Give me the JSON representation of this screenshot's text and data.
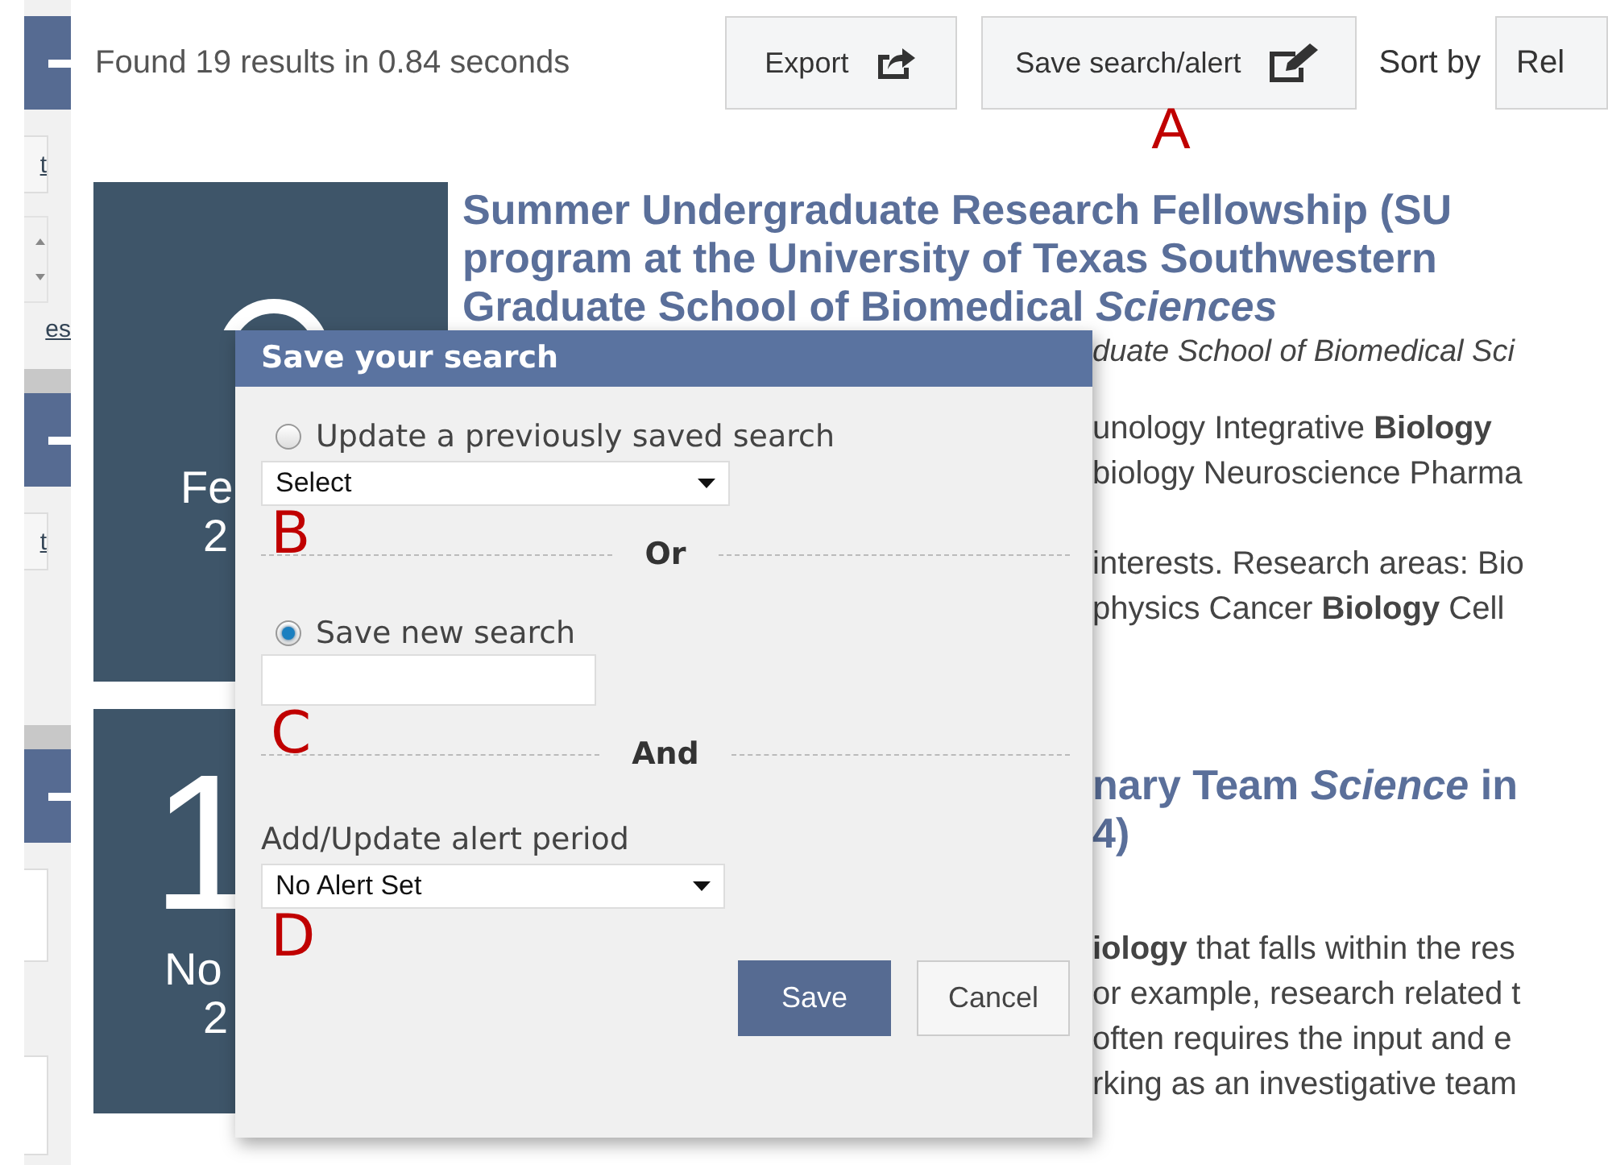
{
  "sidebar": {
    "links": [
      "t",
      "es",
      "t"
    ]
  },
  "toolbar": {
    "summary": "Found 19 results in 0.84 seconds",
    "buttons": [
      {
        "label": "Export",
        "kind": "export"
      },
      {
        "label": "Save search/alert",
        "kind": "edit",
        "annotation": "A"
      }
    ],
    "sort_label": "Sort by",
    "sort_value": "Rel"
  },
  "results": [
    {
      "date": {
        "month": "Fe",
        "year": "2"
      },
      "title_lines": [
        "Summer Undergraduate Research Fellowship (SU",
        "program at the University of Texas Southwestern",
        "Graduate School of Biomedical *Sciences*"
      ],
      "subtitle": "duate School of Biomedical Sci",
      "paragraphs": [
        [
          "unology Integrative **Biology**",
          "biology Neuroscience Pharma"
        ],
        [
          "interests. Research areas: Bio",
          "physics Cancer **Biology** Cell"
        ]
      ]
    },
    {
      "date": {
        "day": "1",
        "month": "No",
        "year": "2"
      },
      "title_lines": [
        "nary Team *Science* in",
        "4)"
      ],
      "paragraphs": [
        [
          "**iology** that falls within the res",
          "or example, research related t",
          "often requires the input and e",
          "rking as an investigative team"
        ]
      ]
    }
  ],
  "dialog": {
    "title": "Save your search",
    "sections": [
      {
        "kind": "radio-select",
        "label": "Update a previously saved search",
        "selected": false,
        "value": "Select",
        "annotation": "B"
      },
      {
        "kind": "separator",
        "label": "Or"
      },
      {
        "kind": "radio-input",
        "label": "Save new search",
        "selected": true,
        "annotation": "C"
      },
      {
        "kind": "separator",
        "label": "And"
      },
      {
        "kind": "select",
        "label": "Add/Update alert period",
        "value": "No Alert Set",
        "annotation": "D"
      }
    ],
    "buttons": [
      {
        "label": "Save",
        "kind": "primary"
      },
      {
        "label": "Cancel",
        "kind": "secondary"
      }
    ]
  }
}
